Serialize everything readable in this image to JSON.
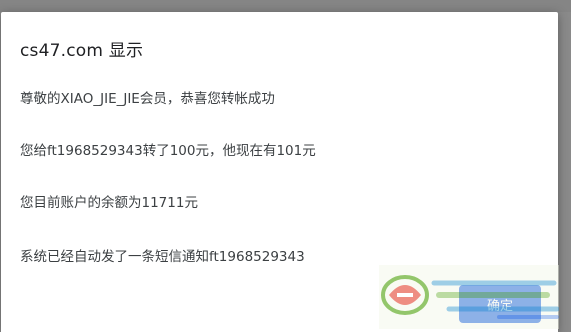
{
  "dialog": {
    "title": "cs47.com 显示",
    "lines": [
      "尊敬的XIAO_JIE_JIE会员，恭喜您转帐成功",
      "您给ft1968529343转了100元，他现在有101元",
      "您目前账户的余额为11711元",
      "系统已经自动发了一条短信通知ft1968529343"
    ],
    "ok_label": "确定"
  },
  "colors": {
    "overlay": "#8a8a8a",
    "dialog_bg": "#ffffff",
    "button": "#3b78e7"
  },
  "watermark": {
    "icon": "site-logo-watermark"
  }
}
